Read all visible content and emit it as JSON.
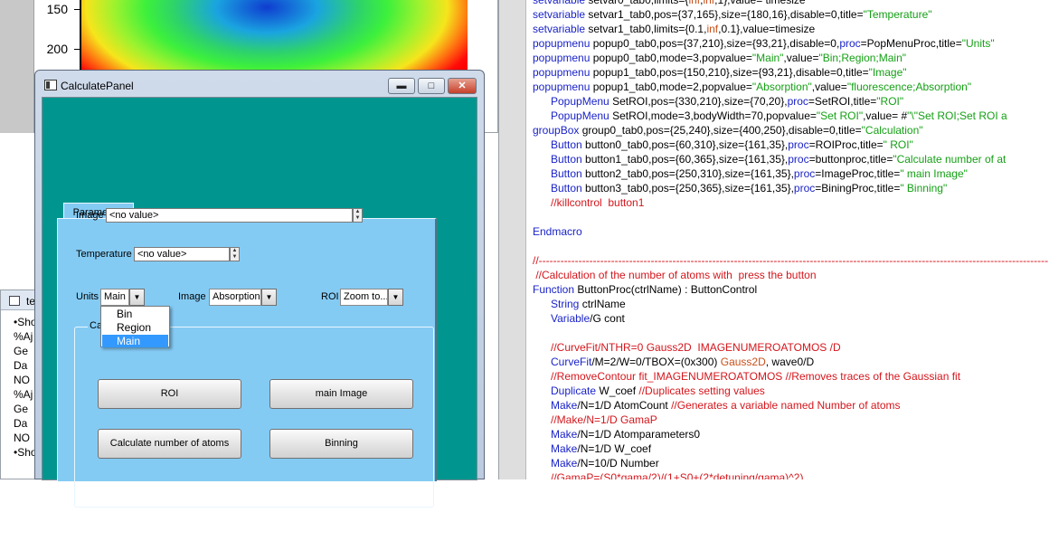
{
  "graph": {
    "y_ticks": [
      "150",
      "200"
    ]
  },
  "editor": {
    "lines": [
      [
        [
          "setvariable",
          "kw"
        ],
        [
          " setvar0_tab0,limits={",
          ""
        ],
        [
          "inf",
          "num"
        ],
        [
          ",",
          ""
        ],
        [
          "inf",
          "num"
        ],
        [
          ",1},value= timesize",
          ""
        ]
      ],
      [
        [
          "setvariable",
          "kw"
        ],
        [
          " setvar1_tab0,pos={37,165},size={180,16},disable=0,title=",
          ""
        ],
        [
          "\"Temperature\"",
          "str"
        ]
      ],
      [
        [
          "setvariable",
          "kw"
        ],
        [
          " setvar1_tab0,limits={0.1,",
          ""
        ],
        [
          "inf",
          "num"
        ],
        [
          ",0.1},value=timesize",
          ""
        ]
      ],
      [
        [
          "popupmenu",
          "kw"
        ],
        [
          " popup0_tab0,pos={37,210},size={93,21},disable=0,",
          ""
        ],
        [
          "proc",
          "kw"
        ],
        [
          "=PopMenuProc,title=",
          ""
        ],
        [
          "\"Units\"",
          "str"
        ]
      ],
      [
        [
          "popupmenu",
          "kw"
        ],
        [
          " popup0_tab0,mode=3,popvalue=",
          ""
        ],
        [
          "\"Main\"",
          "str"
        ],
        [
          ",value=",
          ""
        ],
        [
          "\"Bin;Region;Main\"",
          "str"
        ]
      ],
      [
        [
          "popupmenu",
          "kw"
        ],
        [
          " popup1_tab0,pos={150,210},size={93,21},disable=0,title=",
          ""
        ],
        [
          "\"Image\"",
          "str"
        ]
      ],
      [
        [
          "popupmenu",
          "kw"
        ],
        [
          " popup1_tab0,mode=2,popvalue=",
          ""
        ],
        [
          "\"Absorption\"",
          "str"
        ],
        [
          ",value=",
          ""
        ],
        [
          "\"fluorescence;Absorption\"",
          "str"
        ]
      ],
      [
        [
          "      PopupMenu",
          "kw"
        ],
        [
          " SetROI,pos={330,210},size={70,20},",
          ""
        ],
        [
          "proc",
          "kw"
        ],
        [
          "=SetROI,title=",
          ""
        ],
        [
          "\"ROI\"",
          "str"
        ]
      ],
      [
        [
          "      PopupMenu",
          "kw"
        ],
        [
          " SetROI,mode=3,bodyWidth=70,popvalue=",
          ""
        ],
        [
          "\"Set ROI\"",
          "str"
        ],
        [
          ",value= #",
          ""
        ],
        [
          "\"\\\"Set ROI;Set ROI a",
          "str"
        ]
      ],
      [
        [
          "groupBox",
          "kw"
        ],
        [
          " group0_tab0,pos={25,240},size={400,250},disable=0,title=",
          ""
        ],
        [
          "\"Calculation\"",
          "str"
        ]
      ],
      [
        [
          "      Button",
          "kw"
        ],
        [
          " button0_tab0,pos={60,310},size={161,35},",
          ""
        ],
        [
          "proc",
          "kw"
        ],
        [
          "=ROIProc,title=",
          ""
        ],
        [
          "\" ROI\"",
          "str"
        ]
      ],
      [
        [
          "      Button",
          "kw"
        ],
        [
          " button1_tab0,pos={60,365},size={161,35},",
          ""
        ],
        [
          "proc",
          "kw"
        ],
        [
          "=buttonproc,title=",
          ""
        ],
        [
          "\"Calculate number of at",
          "str"
        ]
      ],
      [
        [
          "      Button",
          "kw"
        ],
        [
          " button2_tab0,pos={250,310},size={161,35},",
          ""
        ],
        [
          "proc",
          "kw"
        ],
        [
          "=ImageProc,title=",
          ""
        ],
        [
          "\" main Image\"",
          "str"
        ]
      ],
      [
        [
          "      Button",
          "kw"
        ],
        [
          " button3_tab0,pos={250,365},size={161,35},",
          ""
        ],
        [
          "proc",
          "kw"
        ],
        [
          "=BiningProc,title=",
          ""
        ],
        [
          "\" Binning\"",
          "str"
        ]
      ],
      [
        [
          "      //killcontrol  button1",
          "cmt"
        ]
      ],
      [
        [
          "",
          ""
        ]
      ],
      [
        [
          "Endmacro",
          "kw"
        ]
      ],
      [
        [
          "",
          ""
        ]
      ],
      [
        [
          "//---------------------------------------------------------------------------------------------------------------------------------------------",
          "cmt"
        ]
      ],
      [
        [
          " //Calculation of the number of atoms with  press the button",
          "cmt"
        ]
      ],
      [
        [
          "Function",
          "kw"
        ],
        [
          " ButtonProc(ctrlName) : ButtonControl",
          ""
        ]
      ],
      [
        [
          "      String",
          "kw"
        ],
        [
          " ctrlName",
          ""
        ]
      ],
      [
        [
          "      Variable",
          "kw"
        ],
        [
          "/G cont",
          ""
        ]
      ],
      [
        [
          "",
          ""
        ]
      ],
      [
        [
          "      //CurveFit/NTHR=0 Gauss2D  IMAGENUMEROATOMOS /D",
          "cmt"
        ]
      ],
      [
        [
          "      CurveFit",
          "kw"
        ],
        [
          "/M=2/W=0/TBOX=(0x300) ",
          ""
        ],
        [
          "Gauss2D",
          "num"
        ],
        [
          ", wave0/D",
          ""
        ]
      ],
      [
        [
          "      //RemoveContour fit_IMAGENUMEROATOMOS //Removes traces of the Gaussian fit",
          "cmt"
        ]
      ],
      [
        [
          "      Duplicate",
          "kw"
        ],
        [
          " W_coef ",
          ""
        ],
        [
          "//Duplicates setting values",
          "cmt"
        ]
      ],
      [
        [
          "      Make",
          "kw"
        ],
        [
          "/N=1/D AtomCount ",
          ""
        ],
        [
          "//Generates a variable named Number of atoms",
          "cmt"
        ]
      ],
      [
        [
          "      //Make/N=1/D GamaP",
          "cmt"
        ]
      ],
      [
        [
          "      Make",
          "kw"
        ],
        [
          "/N=1/D Atomparameters0",
          ""
        ]
      ],
      [
        [
          "      Make",
          "kw"
        ],
        [
          "/N=1/D W_coef",
          ""
        ]
      ],
      [
        [
          "      Make",
          "kw"
        ],
        [
          "/N=10/D Number",
          ""
        ]
      ],
      [
        [
          "      //GamaP=(S0*gama/2)/(1+S0+(2*detuning/gama)^2)",
          "cmt"
        ]
      ]
    ]
  },
  "left_window": {
    "title": "te",
    "lines": [
      "•Sho",
      "%Aj",
      "  Ge",
      "  Da",
      "  NO",
      "%Aj",
      "  Ge",
      "  Da",
      "  NO",
      "•Sho"
    ]
  },
  "calc_panel": {
    "title": "CalculatePanel",
    "tab_label": "Parameters",
    "image_label": "Image",
    "image_value": "<no value>",
    "temperature_label": "Temperature",
    "temperature_value": "<no value>",
    "units_label": "Units",
    "units_value": "Main",
    "image_popup_label": "Image",
    "image_popup_value": "Absorption",
    "roi_label": "ROI",
    "roi_value": "Zoom to...",
    "group_title": "Calc",
    "buttons": {
      "roi": "ROI",
      "main_image": "main Image",
      "calculate": "Calculate number of atoms",
      "binning": "Binning"
    },
    "units_options": [
      "Bin",
      "Region",
      "Main"
    ],
    "units_selected": "Main"
  }
}
